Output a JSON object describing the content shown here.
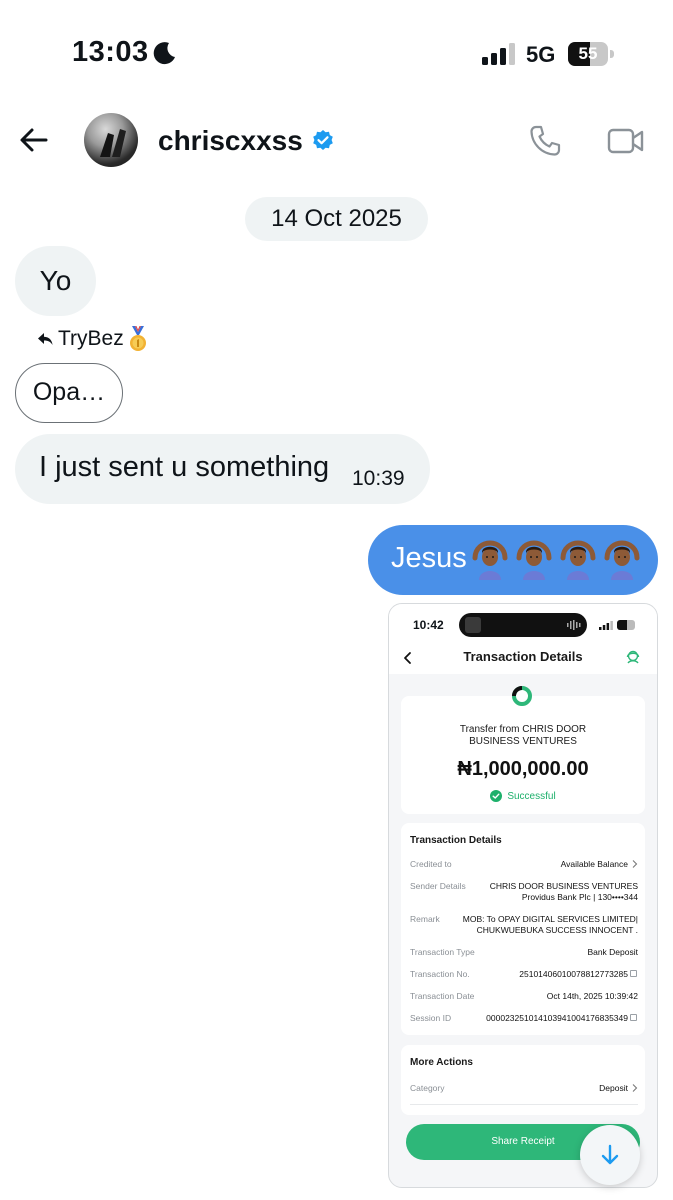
{
  "status_bar": {
    "time": "13:03",
    "network": "5G",
    "battery": "55",
    "battery_level": 0.55
  },
  "header": {
    "username": "chriscxxss",
    "verified": true,
    "icons": [
      "back-arrow-icon",
      "phone-icon",
      "video-camera-icon"
    ]
  },
  "chat": {
    "date": "14 Oct 2025",
    "messages": [
      {
        "direction": "in",
        "text": "Yo"
      },
      {
        "direction": "in",
        "reply_to": "TryBez",
        "reply_emoji": "🥇",
        "text": "Opa…"
      },
      {
        "direction": "in",
        "text": "I just sent u something",
        "time": "10:39"
      },
      {
        "direction": "out",
        "text": "Jesus",
        "emoji": "🙆🏾‍♀️🙆🏾‍♀️🙆🏾‍♀️🙆🏾‍♀️"
      }
    ]
  },
  "receipt": {
    "time": "10:42",
    "battery": "38",
    "title": "Transaction Details",
    "from": "Transfer from CHRIS DOOR BUSINESS VENTURES",
    "from_line1": "Transfer from CHRIS DOOR",
    "from_line2": "BUSINESS VENTURES",
    "amount": "₦1,000,000.00",
    "status": "Successful",
    "details_title": "Transaction Details",
    "rows": [
      {
        "label": "Credited to",
        "value": "Available Balance"
      },
      {
        "label": "Sender Details",
        "value": "CHRIS DOOR BUSINESS VENTURES",
        "value2": "Providus Bank Plc | 130••••344"
      },
      {
        "label": "Remark",
        "value": "MOB: To OPAY DIGITAL SERVICES LIMITED|",
        "value2": "CHUKWUEBUKA SUCCESS INNOCENT ."
      },
      {
        "label": "Transaction Type",
        "value": "Bank Deposit"
      },
      {
        "label": "Transaction No.",
        "value": "25101406010078812773285"
      },
      {
        "label": "Transaction Date",
        "value": "Oct 14th, 2025 10:39:42"
      },
      {
        "label": "Session ID",
        "value": "000023251014103941004176835349"
      }
    ],
    "more_title": "More Actions",
    "category_label": "Category",
    "category_value": "Deposit",
    "share_label": "Share Receipt"
  },
  "colors": {
    "outgoing_bubble": "#4a90e8",
    "incoming_bubble": "#eff3f4",
    "verified": "#1d9bf0",
    "receipt_green": "#2eb779"
  }
}
